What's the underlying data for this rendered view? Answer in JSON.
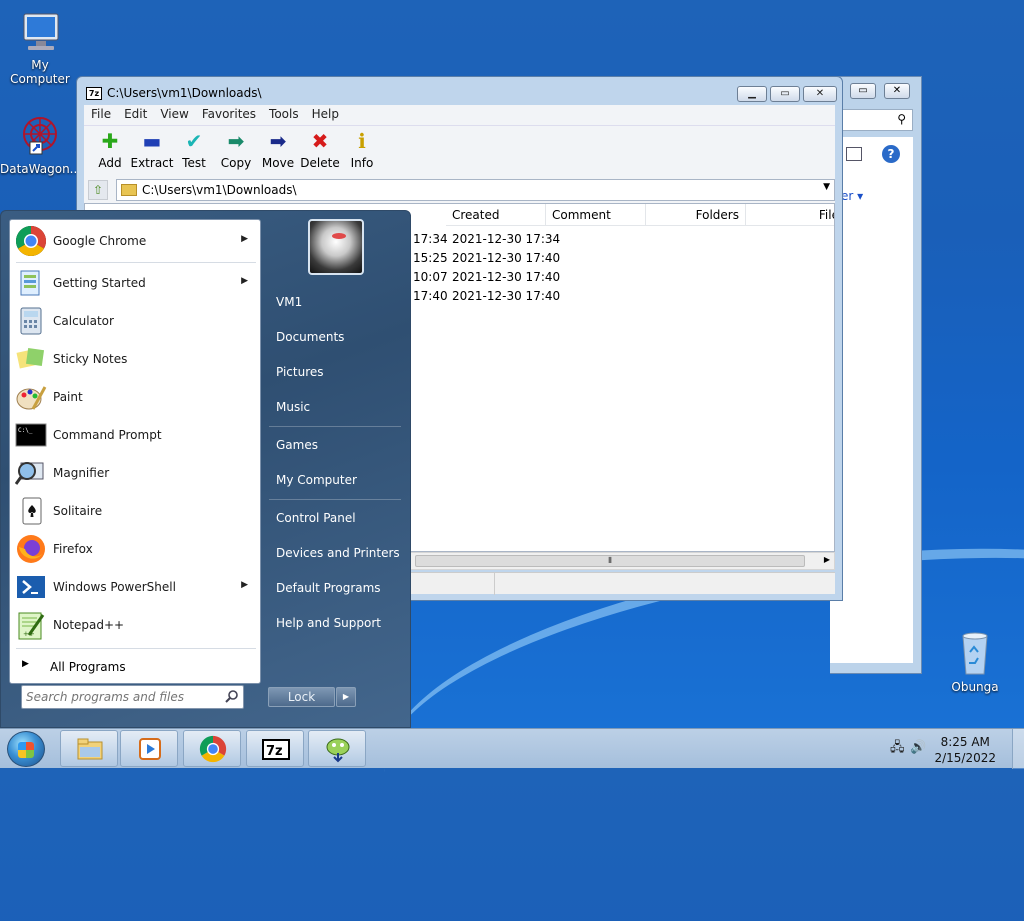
{
  "desktop": {
    "icons": [
      {
        "label": "My Computer"
      },
      {
        "label": "DataWagon..."
      },
      {
        "label": "Obunga"
      }
    ]
  },
  "window": {
    "title": "C:\\Users\\vm1\\Downloads\\",
    "app_icon_text": "7z",
    "controls": {
      "minimize": "▁",
      "maximize": "▭",
      "close": "✕"
    },
    "menu": [
      "File",
      "Edit",
      "View",
      "Favorites",
      "Tools",
      "Help"
    ],
    "toolbar": [
      {
        "label": "Add",
        "icon": "plus-icon",
        "glyph": "✚",
        "color": "#2aa81a"
      },
      {
        "label": "Extract",
        "icon": "minus-icon",
        "glyph": "▬",
        "color": "#1f3fb5"
      },
      {
        "label": "Test",
        "icon": "check-icon",
        "glyph": "✔",
        "color": "#1bb5b5"
      },
      {
        "label": "Copy",
        "icon": "double-arrow-icon",
        "glyph": "➡",
        "color": "#1a8a6a"
      },
      {
        "label": "Move",
        "icon": "arrow-right-icon",
        "glyph": "➡",
        "color": "#1a2a8a"
      },
      {
        "label": "Delete",
        "icon": "x-icon",
        "glyph": "✖",
        "color": "#d61b1b"
      },
      {
        "label": "Info",
        "icon": "info-icon",
        "glyph": "ℹ",
        "color": "#c9a000"
      }
    ],
    "address": "C:\\Users\\vm1\\Downloads\\",
    "columns": [
      "Created",
      "Comment",
      "Folders",
      "File"
    ],
    "rows": [
      {
        "partial": "17:34",
        "created": "2021-12-30 17:34"
      },
      {
        "partial": "15:25",
        "created": "2021-12-30 17:40"
      },
      {
        "partial": "10:07",
        "created": "2021-12-30 17:40"
      },
      {
        "partial": "17:40",
        "created": "2021-12-30 17:40"
      }
    ]
  },
  "explorer_behind": {
    "partial_label": "lder ▾"
  },
  "start_menu": {
    "programs": [
      {
        "label": "Google Chrome",
        "icon": "chrome-icon",
        "submenu": true
      },
      {
        "label": "Getting Started",
        "icon": "getting-started-icon",
        "submenu": true
      },
      {
        "label": "Calculator",
        "icon": "calculator-icon",
        "submenu": false
      },
      {
        "label": "Sticky Notes",
        "icon": "sticky-notes-icon",
        "submenu": false
      },
      {
        "label": "Paint",
        "icon": "paint-icon",
        "submenu": false
      },
      {
        "label": "Command Prompt",
        "icon": "command-prompt-icon",
        "submenu": false
      },
      {
        "label": "Magnifier",
        "icon": "magnifier-icon",
        "submenu": false
      },
      {
        "label": "Solitaire",
        "icon": "solitaire-icon",
        "submenu": false
      },
      {
        "label": "Firefox",
        "icon": "firefox-icon",
        "submenu": false
      },
      {
        "label": "Windows PowerShell",
        "icon": "powershell-icon",
        "submenu": true
      },
      {
        "label": "Notepad++",
        "icon": "notepadpp-icon",
        "submenu": false
      }
    ],
    "all_programs": "All Programs",
    "search_placeholder": "Search programs and files",
    "right_items": [
      "VM1",
      "Documents",
      "Pictures",
      "Music",
      "Games",
      "My Computer",
      "Control Panel",
      "Devices and Printers",
      "Default Programs",
      "Help and Support"
    ],
    "lock_label": "Lock"
  },
  "taskbar": {
    "time": "8:25 AM",
    "date": "2/15/2022",
    "buttons": [
      "file-explorer-icon",
      "media-player-icon",
      "chrome-icon",
      "7zip-icon",
      "notepadpp-icon"
    ]
  }
}
